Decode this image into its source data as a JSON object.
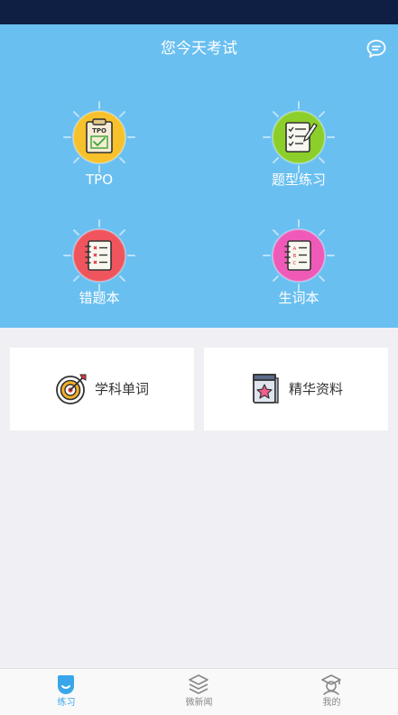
{
  "header": {
    "title": "您今天考试"
  },
  "grid": [
    {
      "label": "TPO",
      "icon": "tpo-clipboard-icon"
    },
    {
      "label": "题型练习",
      "icon": "checklist-icon"
    },
    {
      "label": "错题本",
      "icon": "wrong-notebook-icon"
    },
    {
      "label": "生词本",
      "icon": "vocab-notebook-icon"
    }
  ],
  "cards": [
    {
      "label": "学科单词",
      "icon": "target-icon"
    },
    {
      "label": "精华资料",
      "icon": "star-book-icon"
    }
  ],
  "tabs": [
    {
      "label": "练习",
      "icon": "practice-icon",
      "active": true
    },
    {
      "label": "微新闻",
      "icon": "layers-icon",
      "active": false
    },
    {
      "label": "我的",
      "icon": "profile-icon",
      "active": false
    }
  ],
  "colors": {
    "hero": "#69bff0",
    "status_bar": "#0e1f43",
    "accent": "#3aa6ea",
    "tpo": "#f7c12b",
    "practice": "#8ccf2a",
    "wrong": "#f0555d",
    "vocab": "#ef5ab8"
  }
}
